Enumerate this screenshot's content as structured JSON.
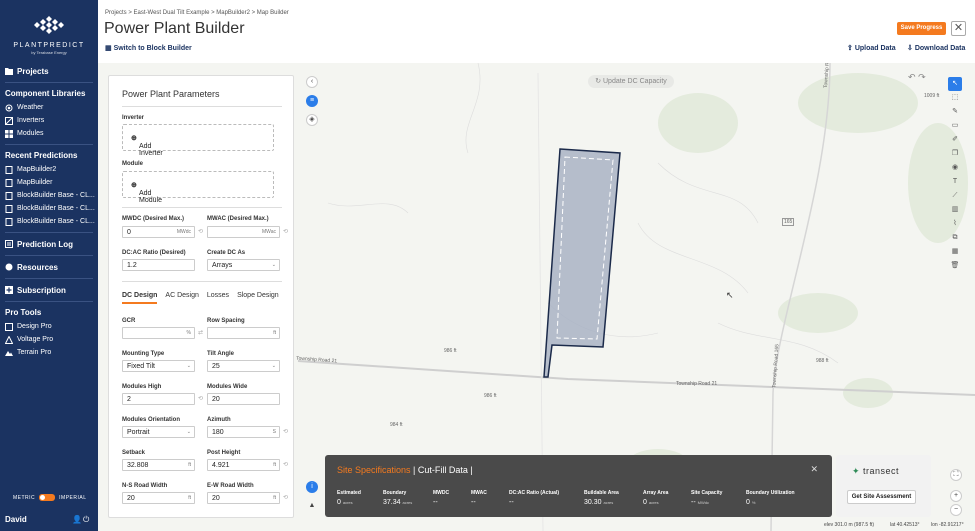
{
  "brand": {
    "name": "PLANTPREDICT",
    "sub": "by Terabase Energy"
  },
  "sidebar": {
    "projects": "Projects",
    "component_libraries": "Component Libraries",
    "libraries": [
      {
        "label": "Weather",
        "icon": "weather-icon"
      },
      {
        "label": "Inverters",
        "icon": "inverter-icon"
      },
      {
        "label": "Modules",
        "icon": "modules-icon"
      }
    ],
    "recent_predictions": "Recent Predictions",
    "recent": [
      {
        "label": "MapBuilder2"
      },
      {
        "label": "MapBuilder"
      },
      {
        "label": "BlockBuilder Base - CL..."
      },
      {
        "label": "BlockBuilder Base - CL..."
      },
      {
        "label": "BlockBuilder Base - CL..."
      }
    ],
    "prediction_log": "Prediction Log",
    "resources": "Resources",
    "subscription": "Subscription",
    "pro_tools": "Pro Tools",
    "tools": [
      {
        "label": "Design Pro"
      },
      {
        "label": "Voltage Pro"
      },
      {
        "label": "Terrain Pro"
      }
    ],
    "metric": "METRIC",
    "imperial": "IMPERIAL",
    "user": "David"
  },
  "header": {
    "breadcrumb": "Projects  >  East-West Dual Tilt Example  >  MapBuilder2  >  Map Builder",
    "title": "Power Plant Builder",
    "switch_label": "Switch to Block Builder",
    "save_label": "Save Progress",
    "close": "✕",
    "upload": "Upload Data",
    "download": "Download Data"
  },
  "map": {
    "update_dc": "Update DC Capacity",
    "labels": {
      "road_21_left": "Township Road 21",
      "road_21_right": "Township Road 21",
      "road_165": "Township Road 165",
      "road_top": "Township Road",
      "h165": "165",
      "e1009": "1009 ft",
      "e986": "986 ft",
      "e986b": "986 ft",
      "e988": "988 ft",
      "e984": "984 ft"
    }
  },
  "params": {
    "title": "Power Plant Parameters",
    "inverter_label": "Inverter",
    "add_inverter": "Add Inverter",
    "module_label": "Module",
    "add_module": "Add Module",
    "mwdc_label": "MWDC (Desired Max.)",
    "mwdc_value": "0",
    "mwdc_unit": "MWdc",
    "mwac_label": "MWAC (Desired Max.)",
    "mwac_value": "",
    "mwac_unit": "MWac",
    "dcac_label": "DC:AC Ratio (Desired)",
    "dcac_value": "1.2",
    "create_dc_label": "Create DC As",
    "create_dc_value": "Arrays",
    "tabs": [
      "DC Design",
      "AC Design",
      "Losses",
      "Slope Design"
    ],
    "gcr_label": "GCR",
    "gcr_value": "",
    "gcr_unit": "%",
    "row_spacing_label": "Row Spacing",
    "row_spacing_value": "",
    "row_spacing_unit": "ft",
    "mounting_label": "Mounting Type",
    "mounting_value": "Fixed Tilt",
    "tilt_label": "Tilt Angle",
    "tilt_value": "25",
    "modules_high_label": "Modules High",
    "modules_high_value": "2",
    "modules_wide_label": "Modules Wide",
    "modules_wide_value": "20",
    "orientation_label": "Modules Orientation",
    "orientation_value": "Portrait",
    "azimuth_label": "Azimuth",
    "azimuth_value": "180",
    "setback_label": "Setback",
    "setback_value": "32.808",
    "setback_unit": "ft",
    "post_height_label": "Post Height",
    "post_height_value": "4.921",
    "post_height_unit": "ft",
    "ns_road_label": "N-S Road Width",
    "ns_road_value": "20",
    "ns_road_unit": "ft",
    "ew_road_label": "E-W Road Width",
    "ew_road_value": "20",
    "ew_road_unit": "ft"
  },
  "spec": {
    "tab1": "Site Specifications",
    "tab2": "Cut-Fill Data",
    "cols": [
      {
        "h": "Estimated",
        "v": "0",
        "u": "acres"
      },
      {
        "h": "Boundary",
        "v": "37.34",
        "u": "acres"
      },
      {
        "h": "MWDC",
        "v": "--",
        "u": ""
      },
      {
        "h": "MWAC",
        "v": "--",
        "u": ""
      },
      {
        "h": "DC:AC Ratio (Actual)",
        "v": "--",
        "u": ""
      },
      {
        "h": "Buildable Area",
        "v": "30.30",
        "u": "acres"
      },
      {
        "h": "Array Area",
        "v": "0",
        "u": "acres"
      },
      {
        "h": "Site Capacity",
        "v": "--",
        "u": "MWdc"
      },
      {
        "h": "Boundary Utilization",
        "v": "0",
        "u": "%"
      }
    ]
  },
  "transect": {
    "name": "transect",
    "button": "Get Site Assessment"
  },
  "status": {
    "elev": "elev 301.0 m (987.5 ft)",
    "lat": "lat 40.42513°",
    "lon": "lon -82.91217°"
  }
}
